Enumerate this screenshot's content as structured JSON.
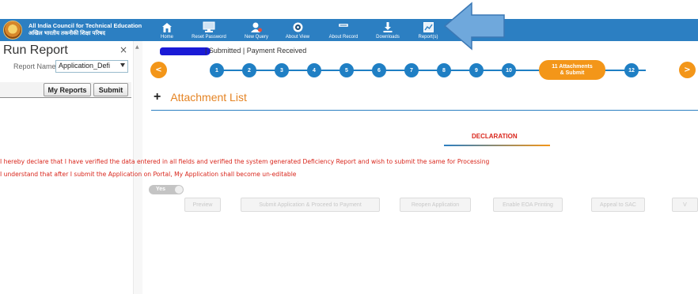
{
  "header": {
    "org_name_en": "All India Council for Technical Education",
    "org_name_hi": "अखिल भारतीय तकनीकी शिक्षा परिषद",
    "nav": [
      {
        "label": "Home",
        "icon": "home-icon"
      },
      {
        "label": "Reset Password",
        "icon": "monitor-icon"
      },
      {
        "label": "New Query",
        "icon": "user-query-icon"
      },
      {
        "label": "About View",
        "icon": "eye-icon"
      },
      {
        "label": "About Record",
        "icon": "record-icon"
      },
      {
        "label": "Downloads",
        "icon": "download-icon"
      },
      {
        "label": "Report(s)",
        "icon": "report-icon"
      }
    ]
  },
  "left_panel": {
    "title": "Run Report",
    "close": "×",
    "report_name_label": "Report Name",
    "report_name_value": "Application_Defi",
    "my_reports_label": "My Reports",
    "submit_label": "Submit"
  },
  "main": {
    "status": "| Submitted | Payment Received",
    "prev": "<",
    "next": ">",
    "steps": [
      "1",
      "2",
      "3",
      "4",
      "5",
      "6",
      "7",
      "8",
      "9",
      "10"
    ],
    "active_step_line1": "11  Attachments",
    "active_step_line2": "& Submit",
    "step_after": "12",
    "attachment_plus": "+",
    "attachment_title": "Attachment List",
    "declaration_title": "DECLARATION",
    "declaration_line1": "I hereby declare that I have verified the data entered in all fields and verified the system generated Deficiency Report and wish to submit the same for Processing",
    "declaration_line2": "I understand that after I submit the Application on Portal, My Application shall become un-editable",
    "toggle_label": "Yes",
    "buttons": [
      "Preview",
      "Submit Application & Proceed to Payment",
      "Reopen Application",
      "Enable EOA Printing",
      "Appeal to SAC",
      "V"
    ]
  },
  "colors": {
    "header_blue": "#2c7fc2",
    "step_blue": "#1f7fc4",
    "accent_orange": "#f39619",
    "declaration_red": "#d9261c",
    "annotation_arrow": "#6fa8dc"
  }
}
